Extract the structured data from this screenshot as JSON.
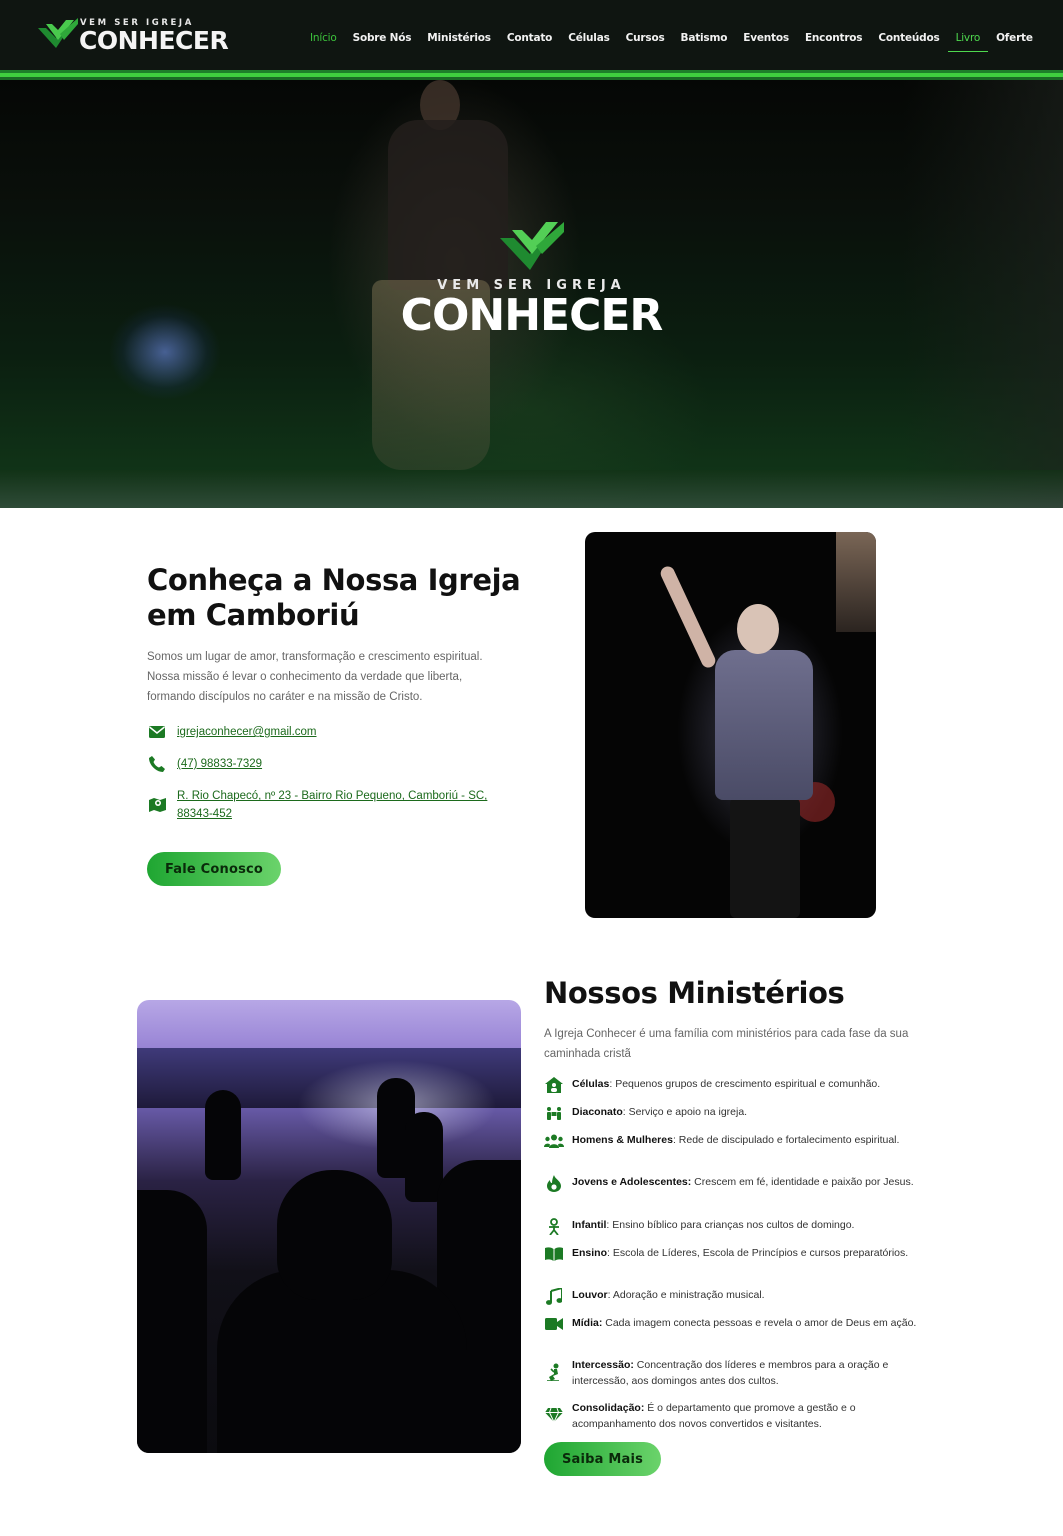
{
  "header": {
    "logo": {
      "top_text": "VEM SER IGREJA",
      "main_text": "CONHECER"
    },
    "nav": [
      {
        "label": "Início",
        "state": "active"
      },
      {
        "label": "Sobre Nós"
      },
      {
        "label": "Ministérios"
      },
      {
        "label": "Contato"
      },
      {
        "label": "Células"
      },
      {
        "label": "Cursos"
      },
      {
        "label": "Batismo"
      },
      {
        "label": "Eventos"
      },
      {
        "label": "Encontros"
      },
      {
        "label": "Conteúdos"
      },
      {
        "label": "Livro",
        "state": "highlighted"
      },
      {
        "label": "Oferte"
      }
    ]
  },
  "hero": {
    "logo_top": "VEM SER IGREJA",
    "logo_main": "CONHECER"
  },
  "about": {
    "title": "Conheça a Nossa Igreja em Camboriú",
    "text": "Somos um lugar de amor, transformação e crescimento espiritual. Nossa missão é levar o conhecimento da verdade que liberta, formando discípulos no caráter e na missão de Cristo.",
    "email": "igrejaconhecer@gmail.com",
    "phone": "(47) 98833-7329",
    "address": "R. Rio Chapecó, nº 23 - Bairro Rio Pequeno, Camboriú - SC, 88343-452",
    "button": "Fale Conosco"
  },
  "ministries": {
    "title": "Nossos Ministérios",
    "intro": "A Igreja Conhecer é uma família com ministérios para cada fase da sua caminhada cristã",
    "items": [
      {
        "name": "Células",
        "desc": ": Pequenos grupos de crescimento espiritual e comunhão.",
        "icon": "house-people-icon"
      },
      {
        "name": "Diaconato",
        "desc": ": Serviço e apoio na igreja.",
        "icon": "people-carry-icon"
      },
      {
        "name": "Homens & Mulheres",
        "desc": ": Rede de discipulado e fortalecimento espiritual.",
        "icon": "users-icon"
      },
      {
        "name": "Jovens e Adolescentes:",
        "desc": " Crescem em fé, identidade e paixão por Jesus.",
        "icon": "fire-icon"
      },
      {
        "name": "Infantil",
        "desc": ": Ensino bíblico para crianças nos cultos de domingo.",
        "icon": "child-icon"
      },
      {
        "name": "Ensino",
        "desc": ": Escola de Líderes, Escola de Princípios e cursos preparatórios.",
        "icon": "book-open-icon"
      },
      {
        "name": "Louvor",
        "desc": ": Adoração e ministração musical.",
        "icon": "music-icon"
      },
      {
        "name": "Mídia:",
        "desc": " Cada imagem conecta pessoas e revela o amor de Deus em ação.",
        "icon": "video-icon"
      },
      {
        "name": "Intercessão:",
        "desc": " Concentração dos líderes e membros para a oração e intercessão, aos domingos antes dos cultos.",
        "icon": "praying-icon"
      },
      {
        "name": "Consolidação:",
        "desc": " É o departamento que promove a gestão e o acompanhamento dos novos convertidos e visitantes.",
        "icon": "gem-icon"
      }
    ],
    "button": "Saiba Mais"
  },
  "colors": {
    "accent": "#3cc23c",
    "dark_green": "#1c6a1c",
    "header_bg": "#0f1511"
  }
}
